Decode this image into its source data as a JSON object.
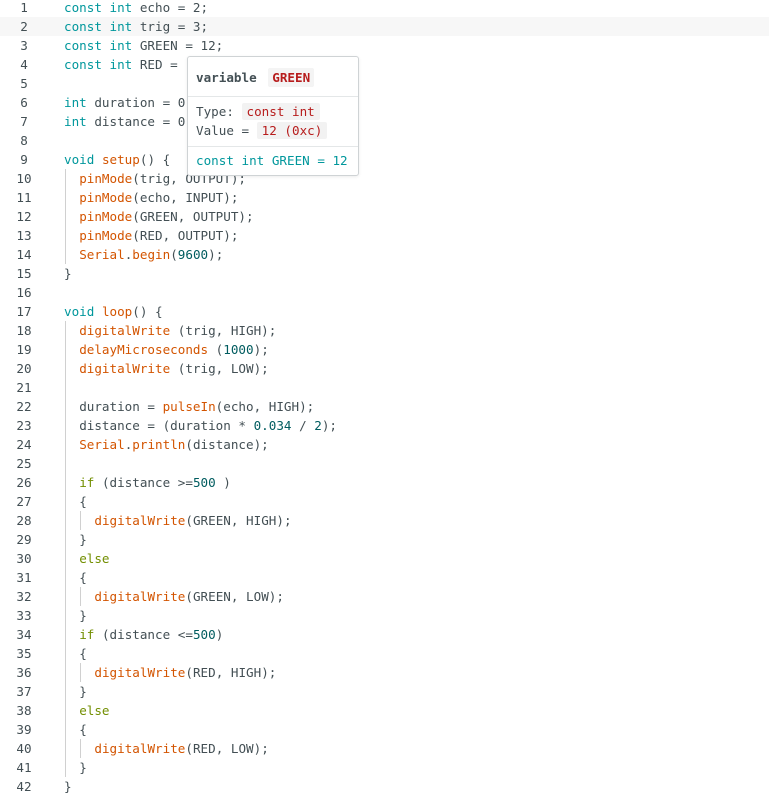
{
  "editor": {
    "current_line": 2,
    "lines": [
      {
        "n": "1",
        "indent": 0,
        "tokens": [
          [
            "kw",
            "const"
          ],
          [
            "",
            " "
          ],
          [
            "kw",
            "int"
          ],
          [
            "",
            " echo = 2;"
          ]
        ]
      },
      {
        "n": "2",
        "indent": 0,
        "tokens": [
          [
            "kw",
            "const"
          ],
          [
            "",
            " "
          ],
          [
            "kw",
            "int"
          ],
          [
            "",
            " trig = 3;"
          ]
        ]
      },
      {
        "n": "3",
        "indent": 0,
        "tokens": [
          [
            "kw",
            "const"
          ],
          [
            "",
            " "
          ],
          [
            "kw",
            "int"
          ],
          [
            "",
            " GREEN = 12;"
          ]
        ]
      },
      {
        "n": "4",
        "indent": 0,
        "tokens": [
          [
            "kw",
            "const"
          ],
          [
            "",
            " "
          ],
          [
            "kw",
            "int"
          ],
          [
            "",
            " RED ="
          ]
        ]
      },
      {
        "n": "5",
        "indent": 0,
        "tokens": []
      },
      {
        "n": "6",
        "indent": 0,
        "tokens": [
          [
            "kw",
            "int"
          ],
          [
            "",
            " duration = 0"
          ]
        ]
      },
      {
        "n": "7",
        "indent": 0,
        "tokens": [
          [
            "kw",
            "int"
          ],
          [
            "",
            " distance = 0"
          ]
        ]
      },
      {
        "n": "8",
        "indent": 0,
        "tokens": []
      },
      {
        "n": "9",
        "indent": 0,
        "tokens": [
          [
            "kw",
            "void"
          ],
          [
            "",
            " "
          ],
          [
            "fn",
            "setup"
          ],
          [
            "",
            "() {"
          ]
        ]
      },
      {
        "n": "10",
        "indent": 1,
        "tokens": [
          [
            "fn",
            "pinMode"
          ],
          [
            "",
            "(trig, OUTPUT);"
          ]
        ]
      },
      {
        "n": "11",
        "indent": 1,
        "tokens": [
          [
            "fn",
            "pinMode"
          ],
          [
            "",
            "(echo, INPUT);"
          ]
        ]
      },
      {
        "n": "12",
        "indent": 1,
        "tokens": [
          [
            "fn",
            "pinMode"
          ],
          [
            "",
            "(GREEN, OUTPUT);"
          ]
        ]
      },
      {
        "n": "13",
        "indent": 1,
        "tokens": [
          [
            "fn",
            "pinMode"
          ],
          [
            "",
            "(RED, OUTPUT);"
          ]
        ]
      },
      {
        "n": "14",
        "indent": 1,
        "tokens": [
          [
            "fn",
            "Serial"
          ],
          [
            "",
            "."
          ],
          [
            "fn",
            "begin"
          ],
          [
            "",
            "("
          ],
          [
            "num",
            "9600"
          ],
          [
            "",
            ");"
          ]
        ]
      },
      {
        "n": "15",
        "indent": 0,
        "tokens": [
          [
            "",
            "}"
          ]
        ]
      },
      {
        "n": "16",
        "indent": 0,
        "tokens": []
      },
      {
        "n": "17",
        "indent": 0,
        "tokens": [
          [
            "kw",
            "void"
          ],
          [
            "",
            " "
          ],
          [
            "fn",
            "loop"
          ],
          [
            "",
            "() {"
          ]
        ]
      },
      {
        "n": "18",
        "indent": 1,
        "tokens": [
          [
            "fn",
            "digitalWrite"
          ],
          [
            "",
            " (trig, HIGH);"
          ]
        ]
      },
      {
        "n": "19",
        "indent": 1,
        "tokens": [
          [
            "fn",
            "delayMicroseconds"
          ],
          [
            "",
            " ("
          ],
          [
            "num",
            "1000"
          ],
          [
            "",
            ");"
          ]
        ]
      },
      {
        "n": "20",
        "indent": 1,
        "tokens": [
          [
            "fn",
            "digitalWrite"
          ],
          [
            "",
            " (trig, LOW);"
          ]
        ]
      },
      {
        "n": "21",
        "indent": 0,
        "tokens": []
      },
      {
        "n": "22",
        "indent": 1,
        "tokens": [
          [
            "",
            "duration = "
          ],
          [
            "fn",
            "pulseIn"
          ],
          [
            "",
            "(echo, HIGH);"
          ]
        ]
      },
      {
        "n": "23",
        "indent": 1,
        "tokens": [
          [
            "",
            "distance = (duration * "
          ],
          [
            "num",
            "0.034"
          ],
          [
            "",
            ""
          ],
          [
            "",
            " / "
          ],
          [
            "num",
            "2"
          ],
          [
            "",
            ");"
          ]
        ]
      },
      {
        "n": "24",
        "indent": 1,
        "tokens": [
          [
            "fn",
            "Serial"
          ],
          [
            "",
            "."
          ],
          [
            "fn",
            "println"
          ],
          [
            "",
            "(distance);"
          ]
        ]
      },
      {
        "n": "25",
        "indent": 0,
        "tokens": []
      },
      {
        "n": "26",
        "indent": 1,
        "tokens": [
          [
            "ctl",
            "if"
          ],
          [
            "",
            " (distance >="
          ],
          [
            "num",
            "500"
          ],
          [
            "",
            " )"
          ]
        ]
      },
      {
        "n": "27",
        "indent": 1,
        "tokens": [
          [
            "",
            "{"
          ]
        ]
      },
      {
        "n": "28",
        "indent": 2,
        "tokens": [
          [
            "fn",
            "digitalWrite"
          ],
          [
            "",
            "(GREEN, HIGH);"
          ]
        ]
      },
      {
        "n": "29",
        "indent": 1,
        "tokens": [
          [
            "",
            "}"
          ]
        ]
      },
      {
        "n": "30",
        "indent": 1,
        "tokens": [
          [
            "ctl",
            "else"
          ]
        ]
      },
      {
        "n": "31",
        "indent": 1,
        "tokens": [
          [
            "",
            "{"
          ]
        ]
      },
      {
        "n": "32",
        "indent": 2,
        "tokens": [
          [
            "fn",
            "digitalWrite"
          ],
          [
            "",
            "(GREEN, LOW);"
          ]
        ]
      },
      {
        "n": "33",
        "indent": 1,
        "tokens": [
          [
            "",
            "}"
          ]
        ]
      },
      {
        "n": "34",
        "indent": 1,
        "tokens": [
          [
            "ctl",
            "if"
          ],
          [
            "",
            " (distance <="
          ],
          [
            "num",
            "500"
          ],
          [
            "",
            ")"
          ]
        ]
      },
      {
        "n": "35",
        "indent": 1,
        "tokens": [
          [
            "",
            "{"
          ]
        ]
      },
      {
        "n": "36",
        "indent": 2,
        "tokens": [
          [
            "fn",
            "digitalWrite"
          ],
          [
            "",
            "(RED, HIGH);"
          ]
        ]
      },
      {
        "n": "37",
        "indent": 1,
        "tokens": [
          [
            "",
            "}"
          ]
        ]
      },
      {
        "n": "38",
        "indent": 1,
        "tokens": [
          [
            "ctl",
            "else"
          ]
        ]
      },
      {
        "n": "39",
        "indent": 1,
        "tokens": [
          [
            "",
            "{"
          ]
        ]
      },
      {
        "n": "40",
        "indent": 2,
        "tokens": [
          [
            "fn",
            "digitalWrite"
          ],
          [
            "",
            "(RED, LOW);"
          ]
        ]
      },
      {
        "n": "41",
        "indent": 1,
        "tokens": [
          [
            "",
            "}"
          ]
        ]
      },
      {
        "n": "42",
        "indent": 0,
        "tokens": [
          [
            "",
            "}"
          ]
        ]
      }
    ]
  },
  "tooltip": {
    "kind_label": "variable",
    "name": "GREEN",
    "type_label": "Type:",
    "type_value": "const int",
    "value_label": "Value =",
    "value_value": "12 (0xc)",
    "declaration": "const int GREEN = 12"
  },
  "colors": {
    "keyword": "#00979c",
    "function": "#d35400",
    "number": "#005c5f",
    "control": "#728e00",
    "text": "#434f54",
    "current_line": "#f7f7f7"
  }
}
